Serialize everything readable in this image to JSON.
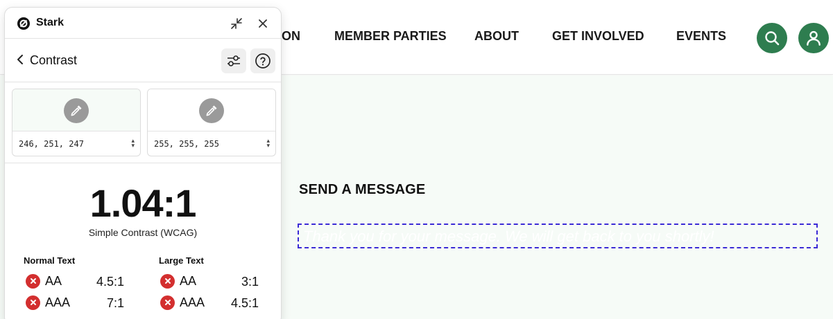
{
  "site": {
    "nav": [
      "ON",
      "MEMBER PARTIES",
      "ABOUT",
      "GET INVOLVED",
      "EVENTS"
    ],
    "send_title": "SEND A MESSAGE",
    "thanks_text": "Thank you for your message. We will get back to you shortly!",
    "accent": "#2e7d4f",
    "main_bg": "#f6fbf7"
  },
  "stark": {
    "app_name": "Stark",
    "section": "Contrast",
    "foreground": {
      "value": "246, 251, 247",
      "color": "#f6fbf7"
    },
    "background": {
      "value": "255, 255, 255",
      "color": "#ffffff"
    },
    "ratio": "1.04:1",
    "ratio_caption": "Simple Contrast (WCAG)",
    "normal_text": {
      "heading": "Normal Text",
      "aa": {
        "label": "AA",
        "value": "4.5:1",
        "status": "fail"
      },
      "aaa": {
        "label": "AAA",
        "value": "7:1",
        "status": "fail"
      }
    },
    "large_text": {
      "heading": "Large Text",
      "aa": {
        "label": "AA",
        "value": "3:1",
        "status": "fail"
      },
      "aaa": {
        "label": "AAA",
        "value": "4.5:1",
        "status": "fail"
      }
    },
    "fail_color": "#d32f2f"
  }
}
